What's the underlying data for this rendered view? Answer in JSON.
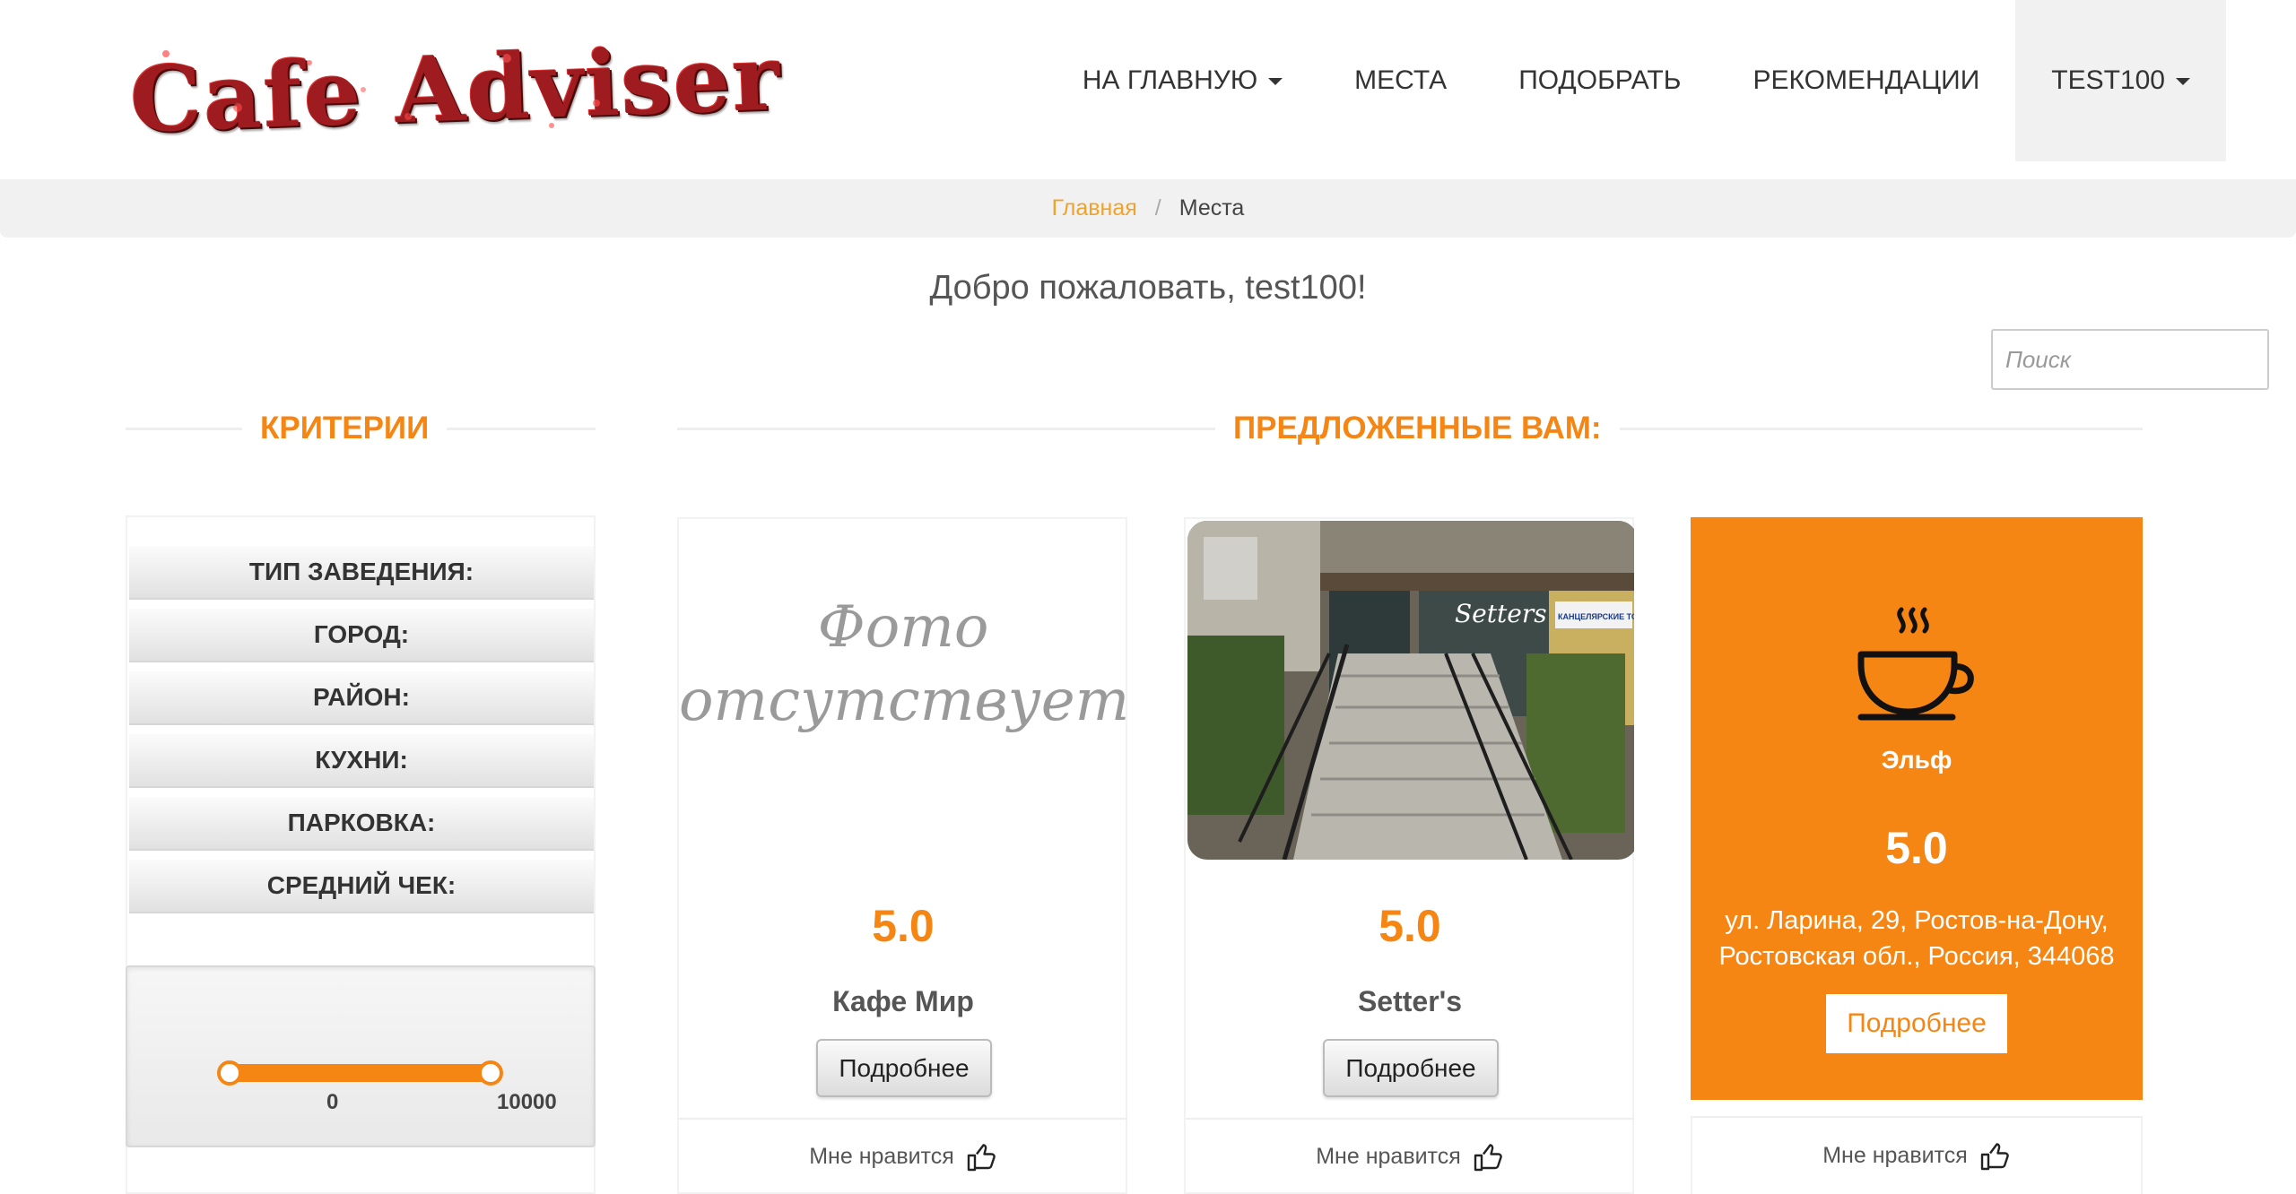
{
  "brand": {
    "logo_text": "Cafe Adviser"
  },
  "nav": {
    "items": [
      {
        "label": "НА ГЛАВНУЮ"
      },
      {
        "label": "МЕСТА"
      },
      {
        "label": "ПОДОБРАТЬ"
      },
      {
        "label": "РЕКОМЕНДАЦИИ"
      },
      {
        "label": "TEST100"
      }
    ]
  },
  "breadcrumb": {
    "home": "Главная",
    "separator": "/",
    "current": "Места"
  },
  "welcome": "Добро пожаловать, test100!",
  "search": {
    "placeholder": "Поиск"
  },
  "criteria": {
    "title": "КРИТЕРИИ",
    "items": [
      "ТИП ЗАВЕДЕНИЯ:",
      "ГОРОД:",
      "РАЙОН:",
      "КУХНИ:",
      "ПАРКОВКА:",
      "СРЕДНИЙ ЧЕК:"
    ],
    "price_range": {
      "min": "0",
      "max": "10000"
    }
  },
  "suggested": {
    "title": "ПРЕДЛОЖЕННЫЕ ВАМ:",
    "cards": [
      {
        "photo_text": "Фото отсутствует",
        "rating": "5.0",
        "name": "Кафе Мир",
        "button": "Подробнее",
        "like": "Мне нравится"
      },
      {
        "photo_sign": "Setters",
        "photo_sign2": "КАНЦЕЛЯРСКИЕ ТОВАРЫ",
        "rating": "5.0",
        "name": "Setter's",
        "button": "Подробнее",
        "like": "Мне нравится"
      },
      {
        "name": "Эльф",
        "rating": "5.0",
        "address": "ул. Ларина, 29, Ростов-на-Дону, Ростовская обл., Россия, 344068",
        "button": "Подробнее",
        "like": "Мне нравится"
      }
    ]
  },
  "colors": {
    "accent": "#f68613",
    "breadcrumb_link": "#f0a32a"
  }
}
